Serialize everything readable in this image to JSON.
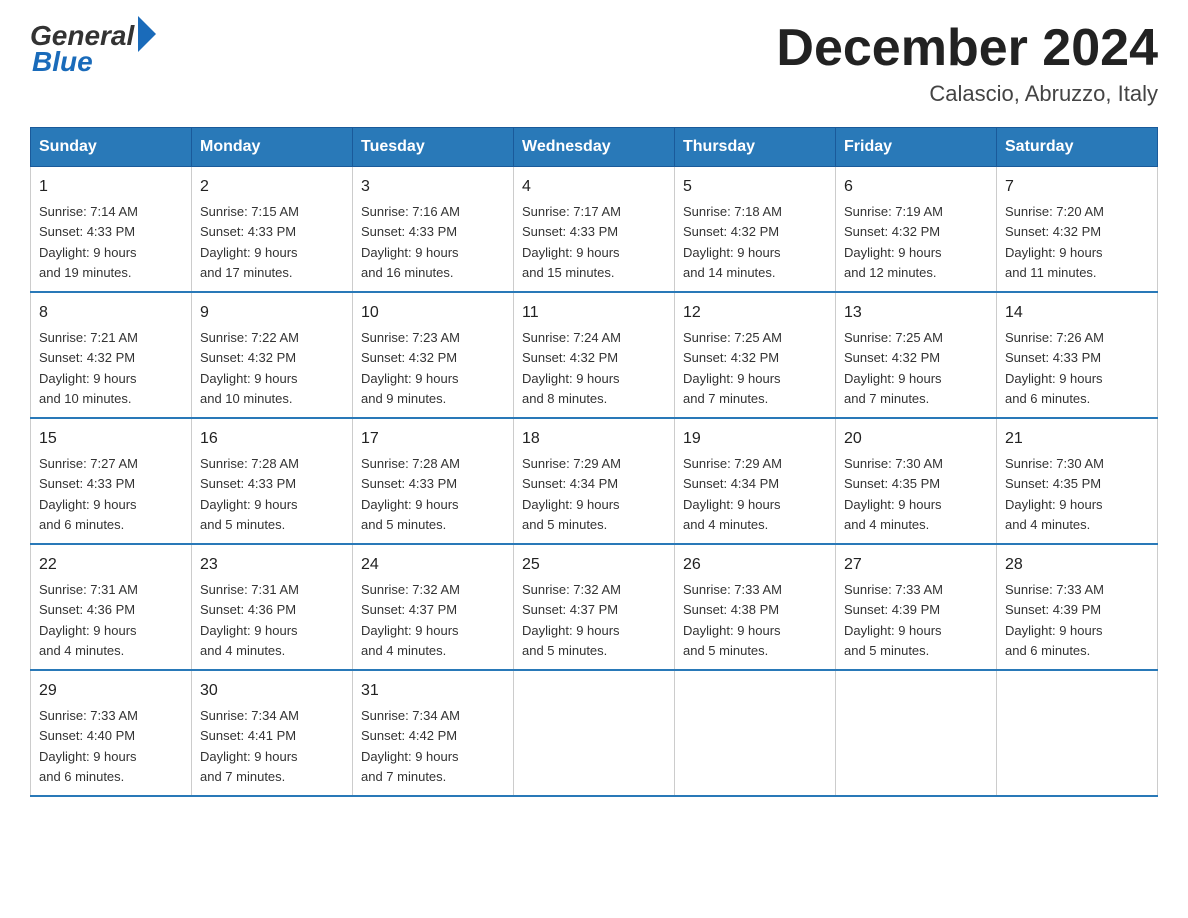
{
  "header": {
    "logo_general": "General",
    "logo_blue": "Blue",
    "month_title": "December 2024",
    "location": "Calascio, Abruzzo, Italy"
  },
  "weekdays": [
    "Sunday",
    "Monday",
    "Tuesday",
    "Wednesday",
    "Thursday",
    "Friday",
    "Saturday"
  ],
  "weeks": [
    [
      {
        "day": "1",
        "sunrise": "7:14 AM",
        "sunset": "4:33 PM",
        "daylight": "9 hours and 19 minutes."
      },
      {
        "day": "2",
        "sunrise": "7:15 AM",
        "sunset": "4:33 PM",
        "daylight": "9 hours and 17 minutes."
      },
      {
        "day": "3",
        "sunrise": "7:16 AM",
        "sunset": "4:33 PM",
        "daylight": "9 hours and 16 minutes."
      },
      {
        "day": "4",
        "sunrise": "7:17 AM",
        "sunset": "4:33 PM",
        "daylight": "9 hours and 15 minutes."
      },
      {
        "day": "5",
        "sunrise": "7:18 AM",
        "sunset": "4:32 PM",
        "daylight": "9 hours and 14 minutes."
      },
      {
        "day": "6",
        "sunrise": "7:19 AM",
        "sunset": "4:32 PM",
        "daylight": "9 hours and 12 minutes."
      },
      {
        "day": "7",
        "sunrise": "7:20 AM",
        "sunset": "4:32 PM",
        "daylight": "9 hours and 11 minutes."
      }
    ],
    [
      {
        "day": "8",
        "sunrise": "7:21 AM",
        "sunset": "4:32 PM",
        "daylight": "9 hours and 10 minutes."
      },
      {
        "day": "9",
        "sunrise": "7:22 AM",
        "sunset": "4:32 PM",
        "daylight": "9 hours and 10 minutes."
      },
      {
        "day": "10",
        "sunrise": "7:23 AM",
        "sunset": "4:32 PM",
        "daylight": "9 hours and 9 minutes."
      },
      {
        "day": "11",
        "sunrise": "7:24 AM",
        "sunset": "4:32 PM",
        "daylight": "9 hours and 8 minutes."
      },
      {
        "day": "12",
        "sunrise": "7:25 AM",
        "sunset": "4:32 PM",
        "daylight": "9 hours and 7 minutes."
      },
      {
        "day": "13",
        "sunrise": "7:25 AM",
        "sunset": "4:32 PM",
        "daylight": "9 hours and 7 minutes."
      },
      {
        "day": "14",
        "sunrise": "7:26 AM",
        "sunset": "4:33 PM",
        "daylight": "9 hours and 6 minutes."
      }
    ],
    [
      {
        "day": "15",
        "sunrise": "7:27 AM",
        "sunset": "4:33 PM",
        "daylight": "9 hours and 6 minutes."
      },
      {
        "day": "16",
        "sunrise": "7:28 AM",
        "sunset": "4:33 PM",
        "daylight": "9 hours and 5 minutes."
      },
      {
        "day": "17",
        "sunrise": "7:28 AM",
        "sunset": "4:33 PM",
        "daylight": "9 hours and 5 minutes."
      },
      {
        "day": "18",
        "sunrise": "7:29 AM",
        "sunset": "4:34 PM",
        "daylight": "9 hours and 5 minutes."
      },
      {
        "day": "19",
        "sunrise": "7:29 AM",
        "sunset": "4:34 PM",
        "daylight": "9 hours and 4 minutes."
      },
      {
        "day": "20",
        "sunrise": "7:30 AM",
        "sunset": "4:35 PM",
        "daylight": "9 hours and 4 minutes."
      },
      {
        "day": "21",
        "sunrise": "7:30 AM",
        "sunset": "4:35 PM",
        "daylight": "9 hours and 4 minutes."
      }
    ],
    [
      {
        "day": "22",
        "sunrise": "7:31 AM",
        "sunset": "4:36 PM",
        "daylight": "9 hours and 4 minutes."
      },
      {
        "day": "23",
        "sunrise": "7:31 AM",
        "sunset": "4:36 PM",
        "daylight": "9 hours and 4 minutes."
      },
      {
        "day": "24",
        "sunrise": "7:32 AM",
        "sunset": "4:37 PM",
        "daylight": "9 hours and 4 minutes."
      },
      {
        "day": "25",
        "sunrise": "7:32 AM",
        "sunset": "4:37 PM",
        "daylight": "9 hours and 5 minutes."
      },
      {
        "day": "26",
        "sunrise": "7:33 AM",
        "sunset": "4:38 PM",
        "daylight": "9 hours and 5 minutes."
      },
      {
        "day": "27",
        "sunrise": "7:33 AM",
        "sunset": "4:39 PM",
        "daylight": "9 hours and 5 minutes."
      },
      {
        "day": "28",
        "sunrise": "7:33 AM",
        "sunset": "4:39 PM",
        "daylight": "9 hours and 6 minutes."
      }
    ],
    [
      {
        "day": "29",
        "sunrise": "7:33 AM",
        "sunset": "4:40 PM",
        "daylight": "9 hours and 6 minutes."
      },
      {
        "day": "30",
        "sunrise": "7:34 AM",
        "sunset": "4:41 PM",
        "daylight": "9 hours and 7 minutes."
      },
      {
        "day": "31",
        "sunrise": "7:34 AM",
        "sunset": "4:42 PM",
        "daylight": "9 hours and 7 minutes."
      },
      null,
      null,
      null,
      null
    ]
  ],
  "labels": {
    "sunrise": "Sunrise:",
    "sunset": "Sunset:",
    "daylight": "Daylight:"
  }
}
